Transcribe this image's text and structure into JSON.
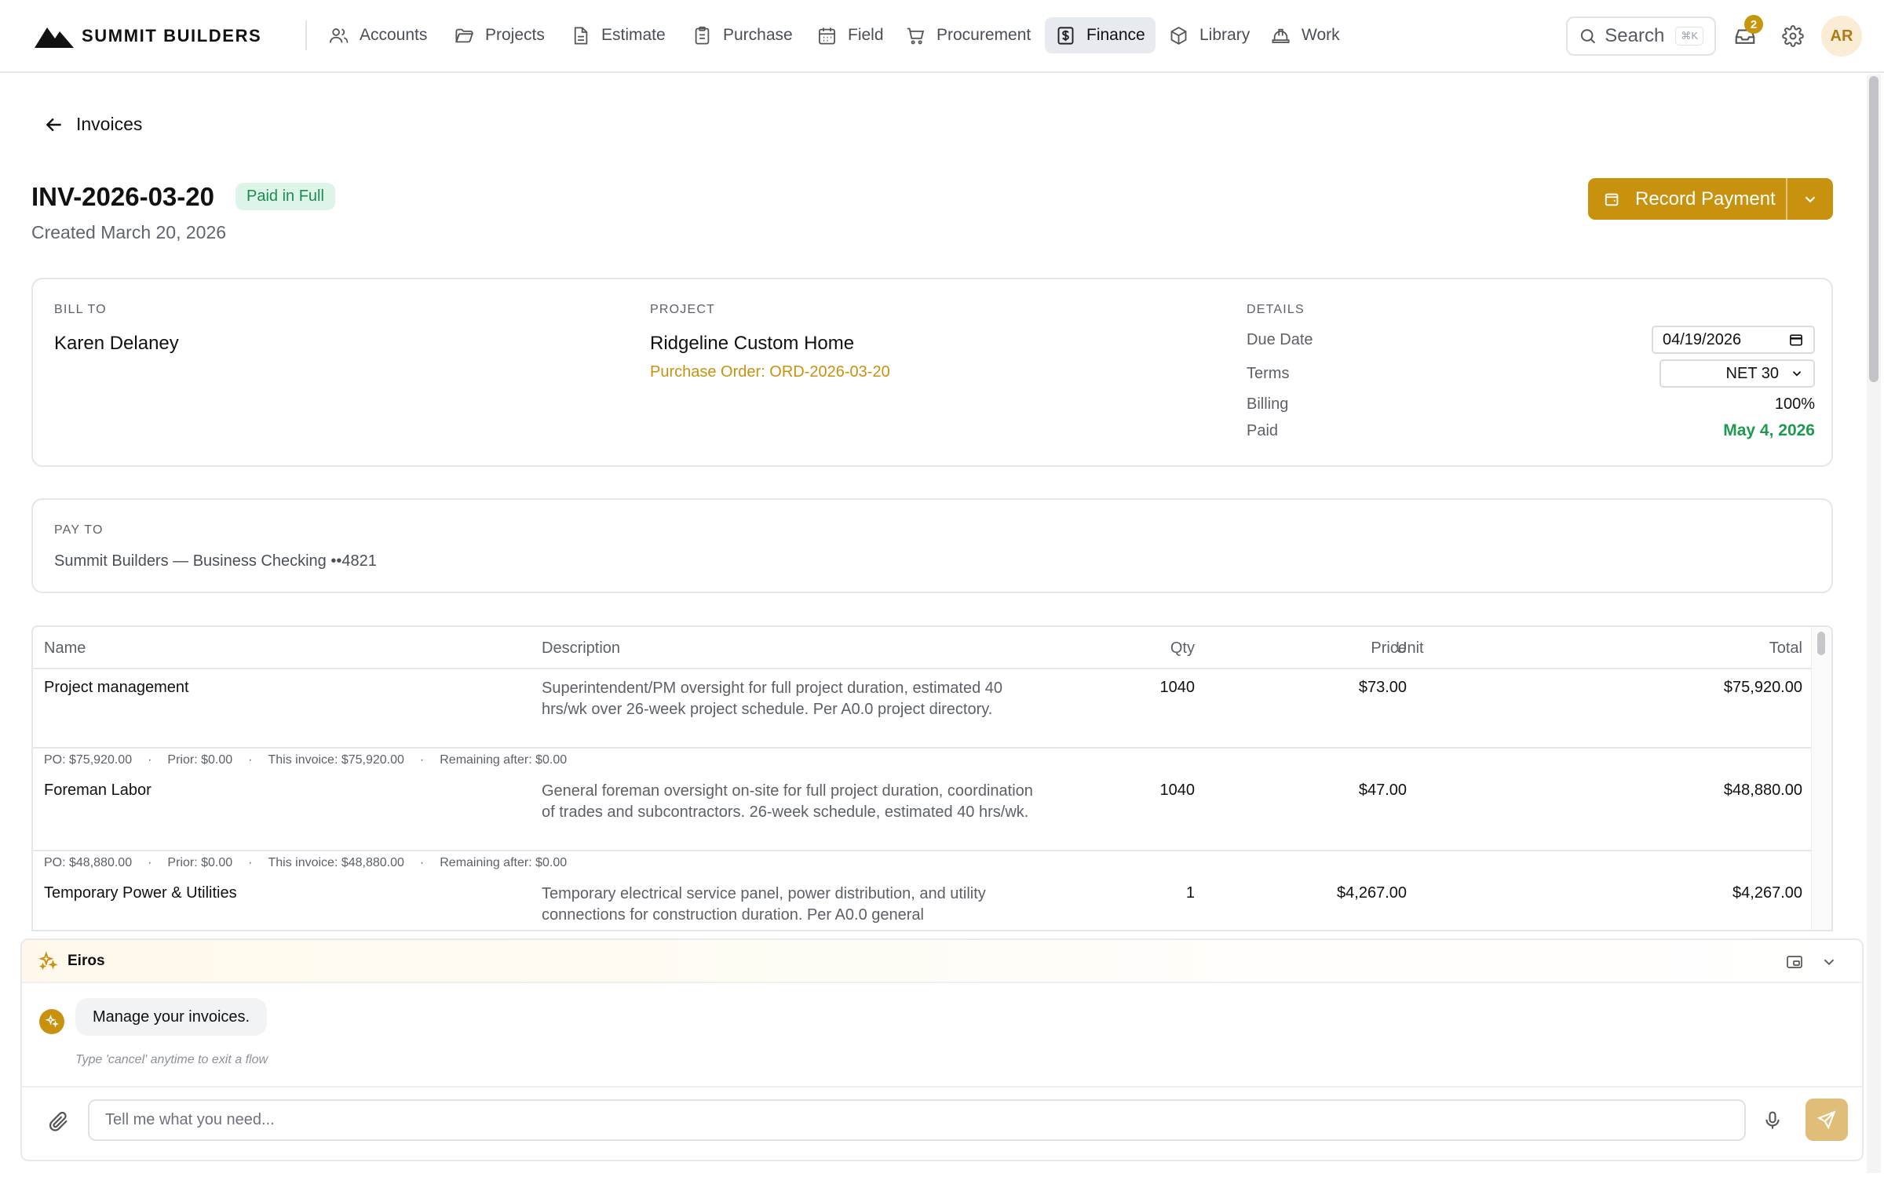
{
  "brand": {
    "name": "SUMMIT BUILDERS"
  },
  "nav": {
    "items": [
      {
        "label": "Accounts",
        "icon": "users-icon"
      },
      {
        "label": "Projects",
        "icon": "folder-icon"
      },
      {
        "label": "Estimate",
        "icon": "document-icon"
      },
      {
        "label": "Purchase",
        "icon": "clipboard-icon"
      },
      {
        "label": "Field",
        "icon": "calendar-icon"
      },
      {
        "label": "Procurement",
        "icon": "cart-icon"
      },
      {
        "label": "Finance",
        "icon": "dollar-icon",
        "active": true
      },
      {
        "label": "Library",
        "icon": "box-icon"
      },
      {
        "label": "Work",
        "icon": "hardhat-icon"
      }
    ],
    "search": {
      "label": "Search",
      "shortcut": "⌘K"
    },
    "inbox_count": "2",
    "user_initials": "AR"
  },
  "page": {
    "back_label": "Invoices",
    "invoice_id": "INV-2026-03-20",
    "status": "Paid in Full",
    "created": "Created March 20, 2026",
    "primary_action": "Record Payment"
  },
  "bill_to": {
    "label": "BILL TO",
    "name": "Karen Delaney"
  },
  "project": {
    "label": "PROJECT",
    "name": "Ridgeline Custom Home",
    "po_link": "Purchase Order: ORD-2026-03-20"
  },
  "details": {
    "label": "DETAILS",
    "due_date_label": "Due Date",
    "due_date": "04/19/2026",
    "terms_label": "Terms",
    "terms": "NET 30",
    "billing_label": "Billing",
    "billing": "100%",
    "paid_label": "Paid",
    "paid": "May 4, 2026"
  },
  "pay_to": {
    "label": "PAY TO",
    "value": "Summit Builders — Business Checking ••4821"
  },
  "table": {
    "headers": {
      "name": "Name",
      "description": "Description",
      "qty": "Qty",
      "price": "Price",
      "unit": "Unit",
      "total": "Total"
    },
    "rows": [
      {
        "name": "Project management",
        "description": "Superintendent/PM oversight for full project duration, estimated 40 hrs/wk over 26-week project schedule. Per A0.0 project directory.",
        "qty": "1040",
        "price": "$73.00",
        "unit": "",
        "total": "$75,920.00",
        "meta": {
          "po": "PO: $75,920.00",
          "prior": "Prior: $0.00",
          "this_invoice": "This invoice: $75,920.00",
          "remaining": "Remaining after: $0.00"
        }
      },
      {
        "name": "Foreman Labor",
        "description": "General foreman oversight on-site for full project duration, coordination of trades and subcontractors. 26-week schedule, estimated 40 hrs/wk.",
        "qty": "1040",
        "price": "$47.00",
        "unit": "",
        "total": "$48,880.00",
        "meta": {
          "po": "PO: $48,880.00",
          "prior": "Prior: $0.00",
          "this_invoice": "This invoice: $48,880.00",
          "remaining": "Remaining after: $0.00"
        }
      },
      {
        "name": "Temporary Power & Utilities",
        "description": "Temporary electrical service panel, power distribution, and utility connections for construction duration. Per A0.0 general",
        "qty": "1",
        "price": "$4,267.00",
        "unit": "",
        "total": "$4,267.00"
      }
    ]
  },
  "chat": {
    "title": "Eiros",
    "message": "Manage your invoices.",
    "hint": "Type 'cancel' anytime to exit a flow",
    "placeholder": "Tell me what you need..."
  },
  "colors": {
    "accent": "#c8910e",
    "success": "#1e9a50",
    "active_nav_bg": "#e7eaef"
  }
}
